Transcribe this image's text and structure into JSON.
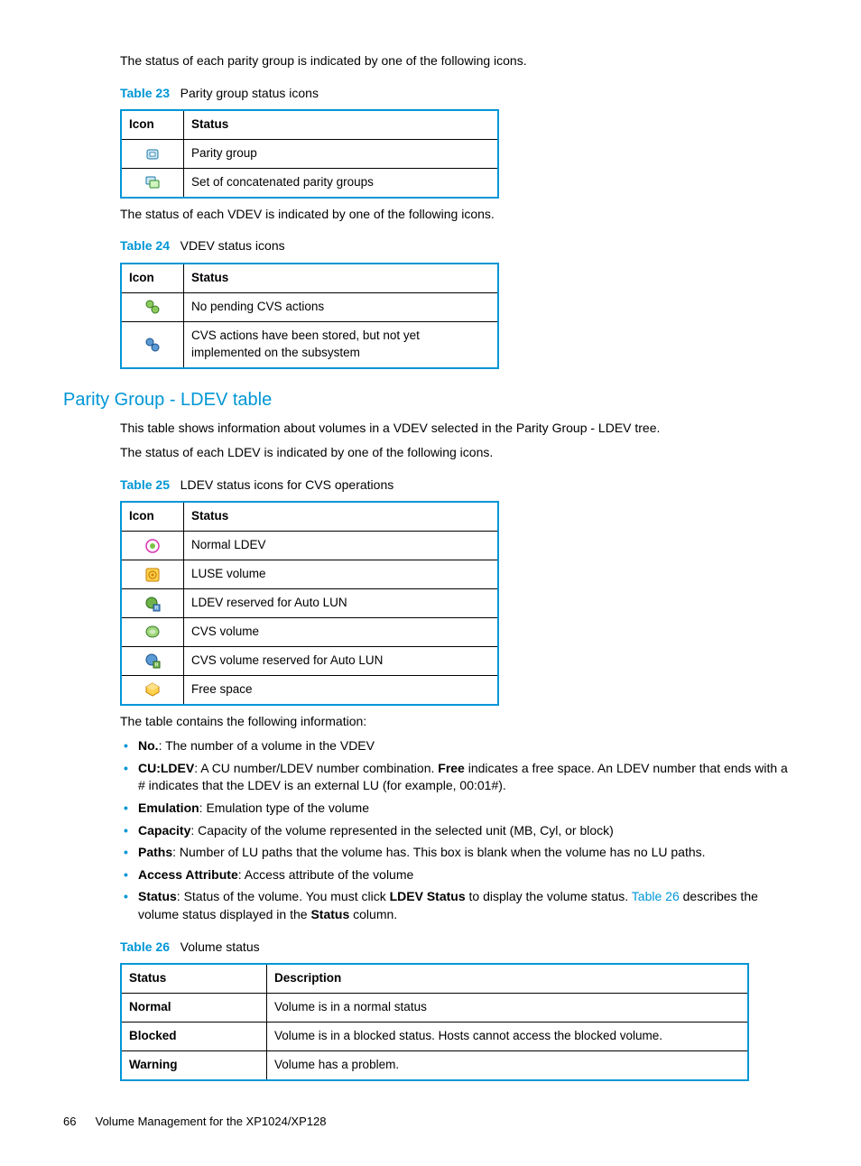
{
  "intro1": "The status of each parity group is indicated by one of the following icons.",
  "t23": {
    "label": "Table 23",
    "title": "Parity group status icons",
    "cols": [
      "Icon",
      "Status"
    ],
    "rows": [
      {
        "icon": "parity-group-icon",
        "status": "Parity group"
      },
      {
        "icon": "concat-parity-group-icon",
        "status": "Set of concatenated parity groups"
      }
    ]
  },
  "intro2": "The status of each VDEV is indicated by one of the following icons.",
  "t24": {
    "label": "Table 24",
    "title": "VDEV status icons",
    "cols": [
      "Icon",
      "Status"
    ],
    "rows": [
      {
        "icon": "vdev-nopending-icon",
        "status": "No pending CVS actions"
      },
      {
        "icon": "vdev-pending-icon",
        "status": "CVS actions have been stored, but not yet implemented on the subsystem"
      }
    ]
  },
  "heading": "Parity Group - LDEV table",
  "h_p1": "This table shows information about volumes in a VDEV selected in the Parity Group - LDEV tree.",
  "h_p2": "The status of each LDEV is indicated by one of the following icons.",
  "t25": {
    "label": "Table 25",
    "title": "LDEV status icons for CVS operations",
    "cols": [
      "Icon",
      "Status"
    ],
    "rows": [
      {
        "icon": "ldev-normal-icon",
        "status": "Normal LDEV"
      },
      {
        "icon": "luse-volume-icon",
        "status": "LUSE volume"
      },
      {
        "icon": "ldev-reserved-autolun-icon",
        "status": "LDEV reserved for Auto LUN"
      },
      {
        "icon": "cvs-volume-icon",
        "status": "CVS volume"
      },
      {
        "icon": "cvs-reserved-autolun-icon",
        "status": "CVS volume reserved for Auto LUN"
      },
      {
        "icon": "free-space-icon",
        "status": "Free space"
      }
    ]
  },
  "table_info": "The table contains the following information:",
  "bullets": [
    {
      "term": "No.",
      "text": ": The number of a volume in the VDEV"
    },
    {
      "term": "CU:LDEV",
      "text_a": ": A CU number/LDEV number combination. ",
      "bold2": "Free",
      "text_b": " indicates a free space. An LDEV number that ends with a # indicates that the LDEV is an external LU (for example, 00:01#)."
    },
    {
      "term": "Emulation",
      "text": ": Emulation type of the volume"
    },
    {
      "term": "Capacity",
      "text": ": Capacity of the volume represented in the selected unit (MB, Cyl, or block)"
    },
    {
      "term": "Paths",
      "text": ": Number of LU paths that the volume has. This box is blank when the volume has no LU paths."
    },
    {
      "term": "Access Attribute",
      "text": ": Access attribute of the volume"
    },
    {
      "term": "Status",
      "text_a": ": Status of the volume. You must click ",
      "bold2": "LDEV Status",
      "text_b": " to display the volume status. ",
      "link": "Table 26",
      "text_c": " describes the volume status displayed in the ",
      "bold3": "Status",
      "text_d": " column."
    }
  ],
  "t26": {
    "label": "Table 26",
    "title": "Volume status",
    "cols": [
      "Status",
      "Description"
    ],
    "rows": [
      {
        "status": "Normal",
        "desc": "Volume is in a normal status"
      },
      {
        "status": "Blocked",
        "desc": "Volume is in a blocked status. Hosts cannot access the blocked volume."
      },
      {
        "status": "Warning",
        "desc": "Volume has a problem."
      }
    ]
  },
  "footer": {
    "page": "66",
    "title": "Volume Management for the XP1024/XP128"
  }
}
